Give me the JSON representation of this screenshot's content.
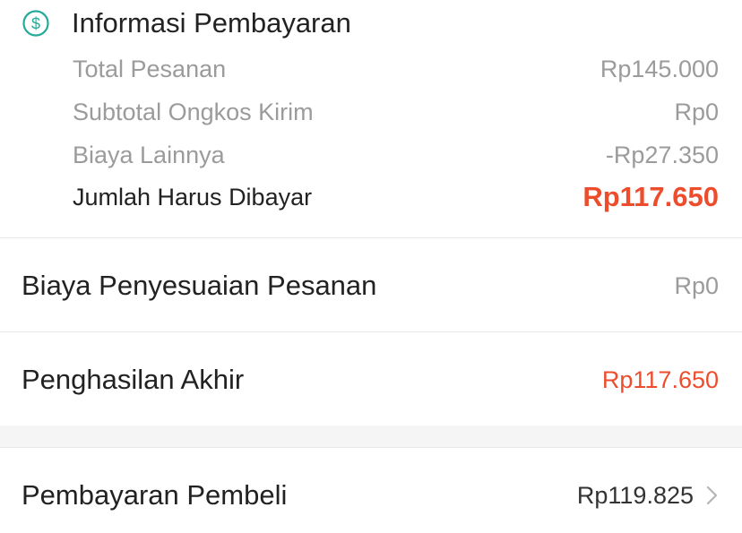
{
  "payment_info": {
    "title": "Informasi Pembayaran",
    "icon": "dollar-circle-icon",
    "rows": [
      {
        "label": "Total Pesanan",
        "value": "Rp145.000"
      },
      {
        "label": "Subtotal Ongkos Kirim",
        "value": "Rp0"
      },
      {
        "label": "Biaya Lainnya",
        "value": "-Rp27.350"
      },
      {
        "label": "Jumlah Harus Dibayar",
        "value": "Rp117.650"
      }
    ]
  },
  "order_adjustment": {
    "label": "Biaya Penyesuaian Pesanan",
    "value": "Rp0"
  },
  "final_income": {
    "label": "Penghasilan Akhir",
    "value": "Rp117.650"
  },
  "buyer_payment": {
    "label": "Pembayaran Pembeli",
    "value": "Rp119.825",
    "icon": "chevron-right-icon"
  },
  "colors": {
    "accent": "#ee4d2d",
    "icon_teal": "#26aa99",
    "muted_text": "#9b9b9b",
    "primary_text": "#222222",
    "divider": "#e8e8e8",
    "section_gap": "#f5f5f5"
  }
}
